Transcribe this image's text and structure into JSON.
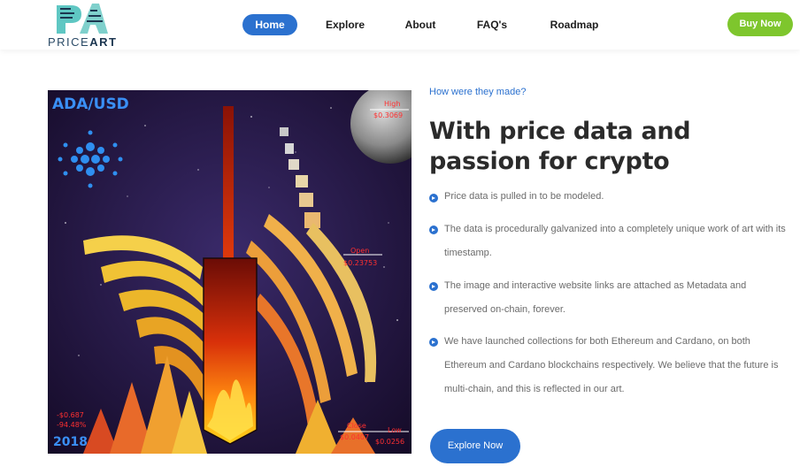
{
  "brand": {
    "logo_letters": "PA",
    "name_price": "PRICE",
    "name_art": "ART"
  },
  "nav": {
    "items": [
      {
        "label": "Home"
      },
      {
        "label": "Explore"
      },
      {
        "label": "About"
      },
      {
        "label": "FAQ's"
      },
      {
        "label": "Roadmap"
      }
    ],
    "active_index": 0,
    "buy_label": "Buy Now"
  },
  "artwork": {
    "pair": "ADA/USD",
    "high_label": "High",
    "high_value": "$0.3069",
    "open_label": "Open",
    "open_value": "$0.23753",
    "close_label": "Close",
    "close_value": "$0.0407",
    "low_label": "Low",
    "low_value": "$0.0256",
    "change_value": "-$0.687",
    "change_percent": "-94.48%",
    "year": "2018"
  },
  "content": {
    "eyebrow": "How were they made?",
    "headline": "With price data and passion for crypto",
    "bullets": [
      "Price data is pulled in to be modeled.",
      "The data is procedurally galvanized into a completely unique work of art with its timestamp.",
      "The image and interactive website links are attached as Metadata and preserved on-chain, forever.",
      "We have launched collections for both Ethereum and Cardano, on both Ethereum and Cardano blockchains respectively. We believe that the future is multi-chain, and this is reflected in our art."
    ],
    "cta_label": "Explore Now"
  },
  "colors": {
    "accent_blue": "#2b71cf",
    "buy_green": "#7ec62d",
    "heading": "#2b2b2b",
    "body_text": "#6b6b6b"
  }
}
